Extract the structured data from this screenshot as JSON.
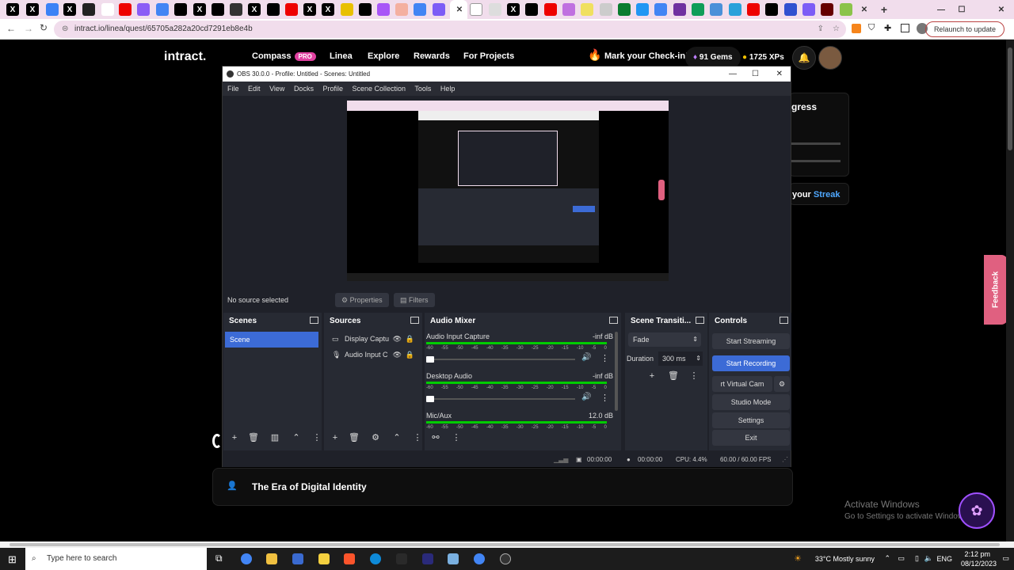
{
  "browser": {
    "url": "intract.io/linea/quest/65705a282a20cd7291eb8e4b",
    "relaunch_label": "Relaunch to update"
  },
  "site": {
    "logo": "intract.",
    "nav": {
      "compass": "Compass",
      "pro_badge": "PRO",
      "linea": "Linea",
      "explore": "Explore",
      "rewards": "Rewards",
      "for_projects": "For Projects"
    },
    "checkin": "Mark your Check-in!",
    "gems": "91 Gems",
    "xps": "1725 XPs",
    "progress_heading": "gress",
    "streak_prefix": "your",
    "streak_word": "Streak",
    "era_title": "The Era of Digital Identity",
    "feedback": "Feedback",
    "activate_title": "Activate Windows",
    "activate_sub": "Go to Settings to activate Windows."
  },
  "obs": {
    "title": "OBS 30.0.0 - Profile: Untitled - Scenes: Untitled",
    "menu": [
      "File",
      "Edit",
      "View",
      "Docks",
      "Profile",
      "Scene Collection",
      "Tools",
      "Help"
    ],
    "no_source": "No source selected",
    "properties": "Properties",
    "filters": "Filters",
    "scenes_title": "Scenes",
    "scene_item": "Scene",
    "sources_title": "Sources",
    "sources": [
      "Display Captu",
      "Audio Input C"
    ],
    "mixer_title": "Audio Mixer",
    "mixer_channels": [
      {
        "name": "Audio Input Capture",
        "level": "-inf dB"
      },
      {
        "name": "Desktop Audio",
        "level": "-inf dB"
      },
      {
        "name": "Mic/Aux",
        "level": "12.0 dB"
      }
    ],
    "meter_ticks": [
      "-60",
      "-55",
      "-50",
      "-45",
      "-40",
      "-35",
      "-30",
      "-25",
      "-20",
      "-15",
      "-10",
      "-5",
      "0"
    ],
    "transitions_title": "Scene Transiti...",
    "transition_value": "Fade",
    "duration_label": "Duration",
    "duration_value": "300 ms",
    "controls_title": "Controls",
    "controls": {
      "start_streaming": "Start Streaming",
      "start_recording": "Start Recording",
      "virtual_cam": "rt Virtual Cam",
      "studio_mode": "Studio Mode",
      "settings": "Settings",
      "exit": "Exit"
    },
    "status": {
      "rec_time": "00:00:00",
      "stream_time": "00:00:00",
      "cpu": "CPU: 4.4%",
      "fps": "60.00 / 60.00 FPS"
    }
  },
  "taskbar": {
    "search_placeholder": "Type here to search",
    "weather": "33°C  Mostly sunny",
    "lang": "ENG",
    "time": "2:12 pm",
    "date": "08/12/2023"
  },
  "colors": {
    "accent_blue": "#3c6bd6",
    "tab_strip": "#f1ddec",
    "obs_bg": "#272a33",
    "feedback_pink": "#e06080"
  }
}
